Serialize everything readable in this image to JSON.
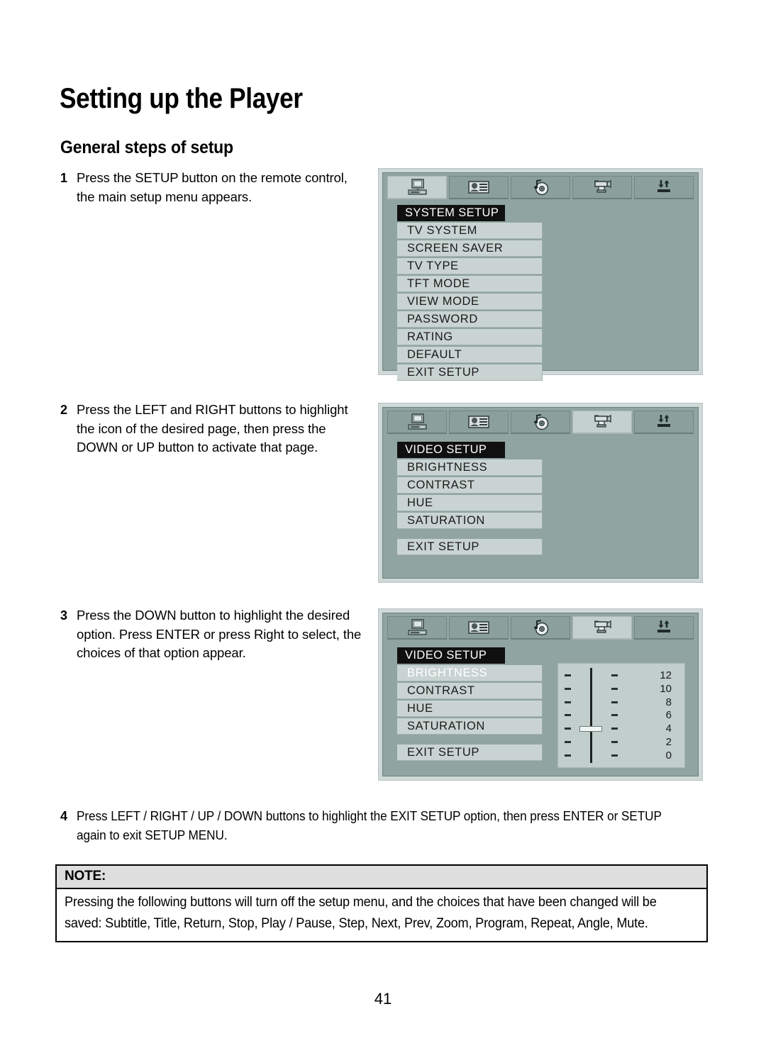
{
  "document": {
    "title": "Setting up the Player",
    "section_heading": "General steps of setup",
    "page_number": "41"
  },
  "steps": [
    {
      "number": "1",
      "text": "Press the SETUP button on the remote control, the main setup menu appears."
    },
    {
      "number": "2",
      "text": "Press the LEFT and RIGHT buttons to highlight the icon of the desired page, then press the DOWN or UP button to activate that page."
    },
    {
      "number": "3",
      "text": "Press the DOWN button to highlight the desired option. Press ENTER or press Right to select, the choices of that option appear."
    },
    {
      "number": "4",
      "text": "Press LEFT / RIGHT / UP / DOWN buttons to highlight the EXIT SETUP option, then press ENTER or SETUP again to exit SETUP MENU."
    }
  ],
  "osd_tabs": [
    {
      "name": "general-setup-icon",
      "label": "GENERAL SETUP"
    },
    {
      "name": "language-setup-icon",
      "label": "LANGUAGE SETUP"
    },
    {
      "name": "audio-setup-icon",
      "label": "AUDIO SETUP"
    },
    {
      "name": "video-setup-icon",
      "label": "VIDEO SETUP"
    },
    {
      "name": "preference-setup-icon",
      "label": "PREFERENCE SETUP"
    }
  ],
  "osd_screens": [
    {
      "id": "system-setup",
      "active_tab_index": 0,
      "header": "SYSTEM SETUP",
      "items": [
        "TV SYSTEM",
        "SCREEN SAVER",
        "TV TYPE",
        "TFT MODE",
        "VIEW MODE",
        "PASSWORD",
        "RATING",
        "DEFAULT",
        "EXIT SETUP"
      ],
      "selected_item": null
    },
    {
      "id": "video-setup",
      "active_tab_index": 3,
      "header": "VIDEO SETUP",
      "items": [
        "BRIGHTNESS",
        "CONTRAST",
        "HUE",
        "SATURATION"
      ],
      "exit_item": "EXIT SETUP",
      "selected_item": null
    },
    {
      "id": "video-setup-brightness",
      "active_tab_index": 3,
      "header": "VIDEO SETUP",
      "items": [
        "BRIGHTNESS",
        "CONTRAST",
        "HUE",
        "SATURATION"
      ],
      "exit_item": "EXIT SETUP",
      "selected_item": "BRIGHTNESS",
      "slider": {
        "labels": [
          "12",
          "10",
          "8",
          "6",
          "4",
          "2",
          "0"
        ],
        "value": "4",
        "min": "0",
        "max": "12",
        "tick_count": 7
      }
    }
  ],
  "note": {
    "title": "NOTE:",
    "body": "Pressing the following buttons will turn off the setup menu, and the choices that have been changed will be saved: Subtitle, Title, Return, Stop, Play / Pause, Step, Next, Prev, Zoom, Program, Repeat, Angle, Mute."
  },
  "colors": {
    "osd_background": "#90a4a1",
    "osd_item": "#c9d4d2",
    "osd_header": "#101010",
    "osd_tab_active": "#c4d0ce",
    "note_header": "#dedede"
  }
}
